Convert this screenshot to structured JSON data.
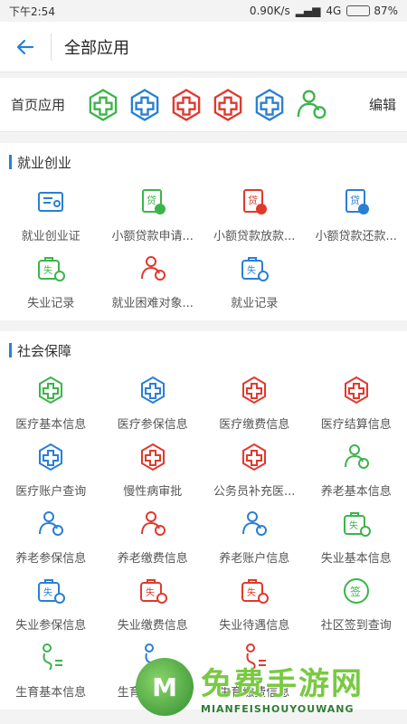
{
  "status": {
    "time": "下午2:54",
    "speed": "0.90K/s",
    "network": "4G",
    "battery": "87%",
    "battery_level": 0.87
  },
  "topbar": {
    "title": "全部应用"
  },
  "home_apps": {
    "label": "首页应用",
    "edit": "编辑"
  },
  "sections": [
    {
      "title": "就业创业",
      "items": [
        "就业创业证",
        "小额贷款申请...",
        "小额贷款放款...",
        "小额贷款还款...",
        "失业记录",
        "就业困难对象...",
        "就业记录"
      ]
    },
    {
      "title": "社会保障",
      "items": [
        "医疗基本信息",
        "医疗参保信息",
        "医疗缴费信息",
        "医疗结算信息",
        "医疗账户查询",
        "慢性病审批",
        "公务员补充医...",
        "养老基本信息",
        "养老参保信息",
        "养老缴费信息",
        "养老账户信息",
        "失业基本信息",
        "失业参保信息",
        "失业缴费信息",
        "失业待遇信息",
        "社区签到查询",
        "生育基本信息",
        "生育参保信息",
        "生育缴费信息"
      ]
    }
  ],
  "watermark": {
    "logo": "M",
    "title": "免费手游网",
    "subtitle": "MIANFEISHOUYOUWANG"
  },
  "colors": {
    "blue": "#2a7fd4",
    "green": "#3cb44b",
    "red": "#e0392c"
  }
}
